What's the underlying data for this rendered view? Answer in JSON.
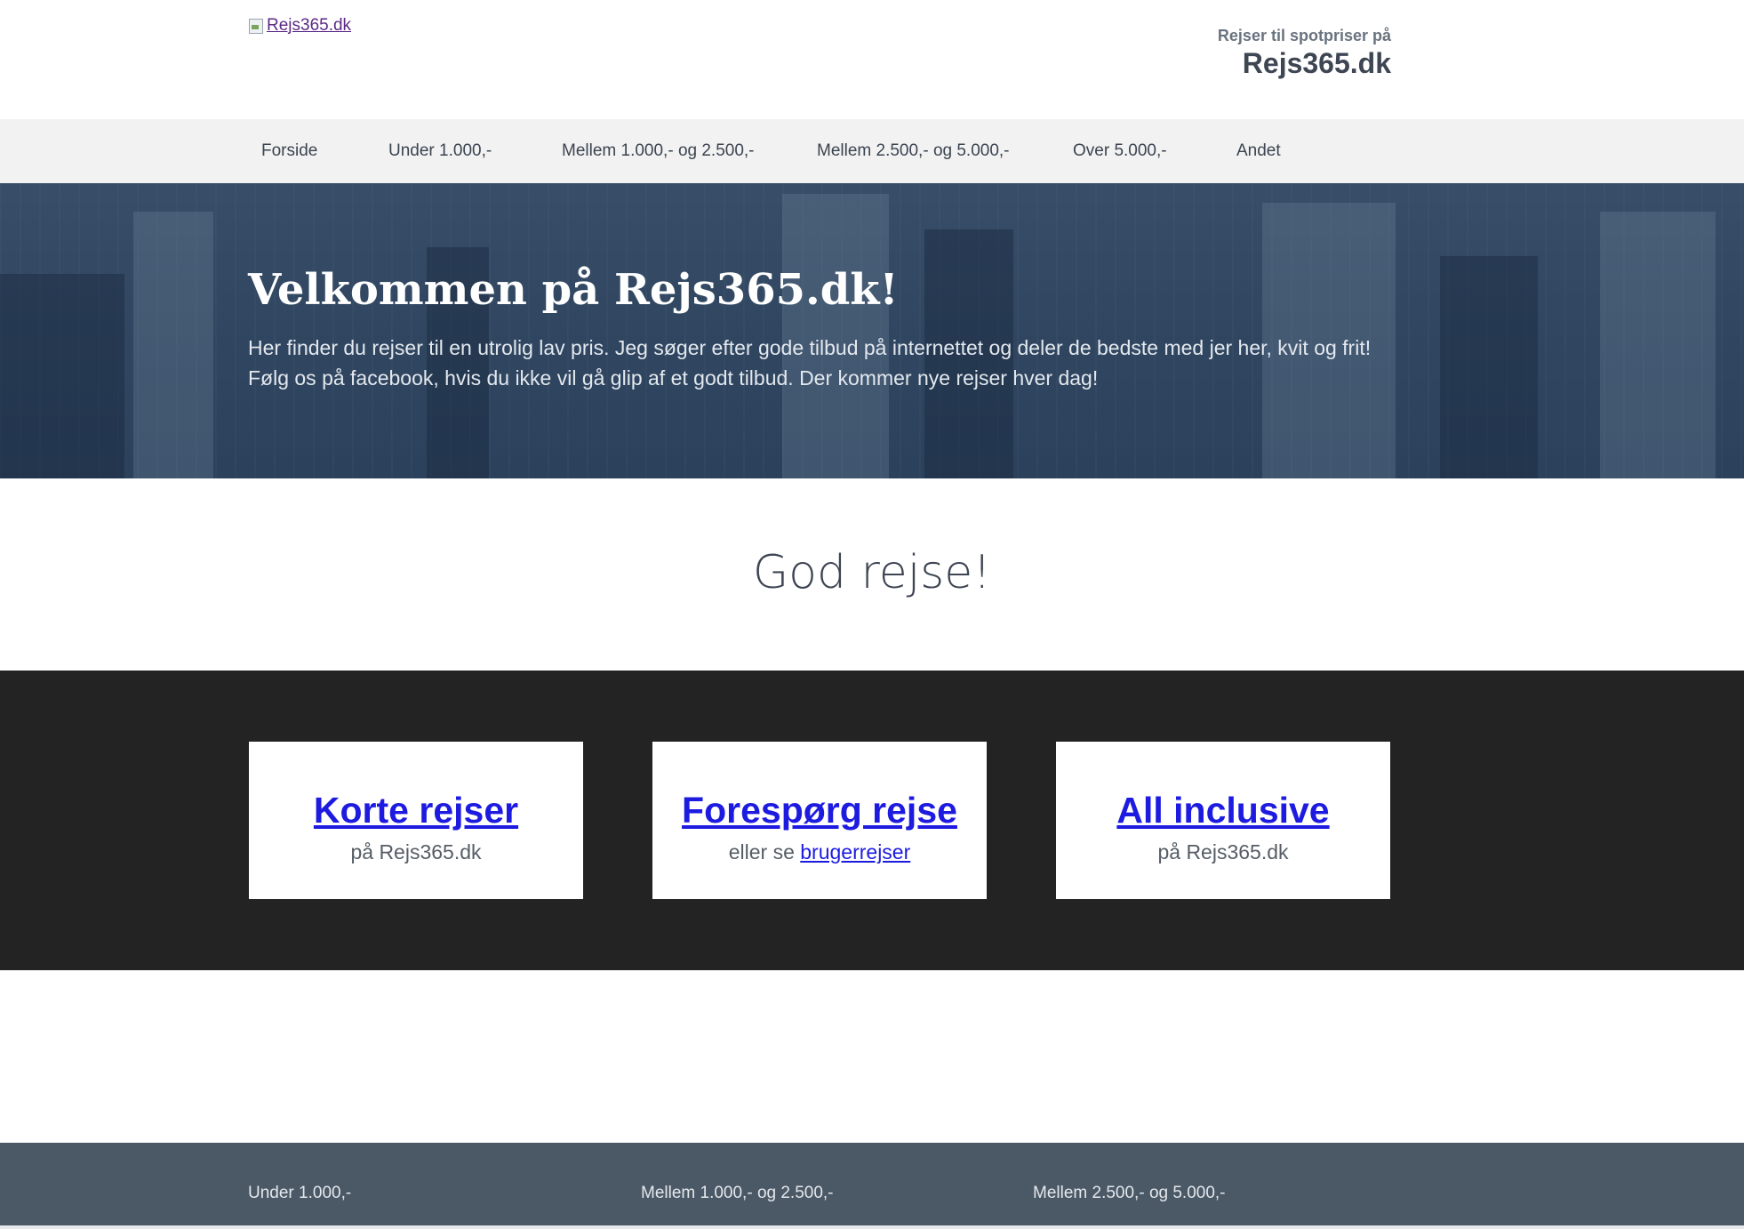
{
  "header": {
    "logo_alt": "Rejs365.dk",
    "tagline_small": "Rejser til spotpriser på",
    "tagline_big": "Rejs365.dk"
  },
  "nav": {
    "items": [
      {
        "label": "Forside"
      },
      {
        "label": "Under 1.000,-"
      },
      {
        "label": "Mellem 1.000,- og 2.500,-"
      },
      {
        "label": "Mellem 2.500,- og 5.000,-"
      },
      {
        "label": "Over 5.000,-"
      },
      {
        "label": "Andet"
      }
    ]
  },
  "hero": {
    "title": "Velkommen på Rejs365.dk!",
    "line1": "Her finder du rejser til en utrolig lav pris. Jeg søger efter gode tilbud på internettet og deler de bedste med jer her, kvit og frit!",
    "line2": "Følg os på facebook, hvis du ikke vil gå glip af et godt tilbud. Der kommer nye rejser hver dag!"
  },
  "welcome": {
    "title": "God rejse!"
  },
  "cards": [
    {
      "title": "Korte rejser",
      "sub": "på Rejs365.dk"
    },
    {
      "title": "Forespørg rejse",
      "sub_prefix": "eller se",
      "sub_link": "brugerrejser"
    },
    {
      "title": "All inclusive",
      "sub": "på Rejs365.dk"
    }
  ],
  "footer": {
    "links": [
      {
        "label": "Under 1.000,-"
      },
      {
        "label": "Mellem 1.000,- og 2.500,-"
      },
      {
        "label": "Mellem 2.500,- og 5.000,-"
      }
    ]
  },
  "colors": {
    "link": "#1d1be0",
    "dark_bg": "#232323",
    "footer_bg": "#4b5866",
    "nav_bg": "#f2f2f2"
  }
}
